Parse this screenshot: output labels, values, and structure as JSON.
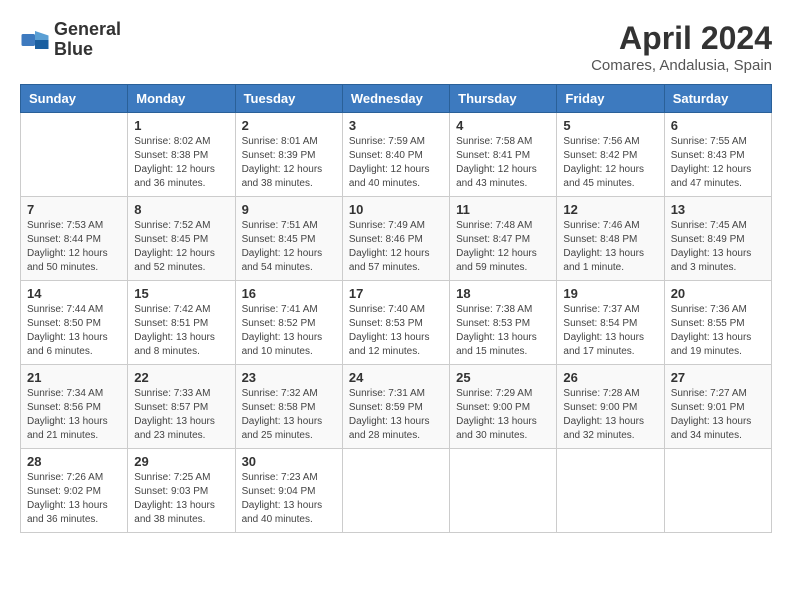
{
  "header": {
    "logo_line1": "General",
    "logo_line2": "Blue",
    "title": "April 2024",
    "subtitle": "Comares, Andalusia, Spain"
  },
  "weekdays": [
    "Sunday",
    "Monday",
    "Tuesday",
    "Wednesday",
    "Thursday",
    "Friday",
    "Saturday"
  ],
  "weeks": [
    [
      {
        "day": "",
        "info": ""
      },
      {
        "day": "1",
        "info": "Sunrise: 8:02 AM\nSunset: 8:38 PM\nDaylight: 12 hours\nand 36 minutes."
      },
      {
        "day": "2",
        "info": "Sunrise: 8:01 AM\nSunset: 8:39 PM\nDaylight: 12 hours\nand 38 minutes."
      },
      {
        "day": "3",
        "info": "Sunrise: 7:59 AM\nSunset: 8:40 PM\nDaylight: 12 hours\nand 40 minutes."
      },
      {
        "day": "4",
        "info": "Sunrise: 7:58 AM\nSunset: 8:41 PM\nDaylight: 12 hours\nand 43 minutes."
      },
      {
        "day": "5",
        "info": "Sunrise: 7:56 AM\nSunset: 8:42 PM\nDaylight: 12 hours\nand 45 minutes."
      },
      {
        "day": "6",
        "info": "Sunrise: 7:55 AM\nSunset: 8:43 PM\nDaylight: 12 hours\nand 47 minutes."
      }
    ],
    [
      {
        "day": "7",
        "info": "Sunrise: 7:53 AM\nSunset: 8:44 PM\nDaylight: 12 hours\nand 50 minutes."
      },
      {
        "day": "8",
        "info": "Sunrise: 7:52 AM\nSunset: 8:45 PM\nDaylight: 12 hours\nand 52 minutes."
      },
      {
        "day": "9",
        "info": "Sunrise: 7:51 AM\nSunset: 8:45 PM\nDaylight: 12 hours\nand 54 minutes."
      },
      {
        "day": "10",
        "info": "Sunrise: 7:49 AM\nSunset: 8:46 PM\nDaylight: 12 hours\nand 57 minutes."
      },
      {
        "day": "11",
        "info": "Sunrise: 7:48 AM\nSunset: 8:47 PM\nDaylight: 12 hours\nand 59 minutes."
      },
      {
        "day": "12",
        "info": "Sunrise: 7:46 AM\nSunset: 8:48 PM\nDaylight: 13 hours\nand 1 minute."
      },
      {
        "day": "13",
        "info": "Sunrise: 7:45 AM\nSunset: 8:49 PM\nDaylight: 13 hours\nand 3 minutes."
      }
    ],
    [
      {
        "day": "14",
        "info": "Sunrise: 7:44 AM\nSunset: 8:50 PM\nDaylight: 13 hours\nand 6 minutes."
      },
      {
        "day": "15",
        "info": "Sunrise: 7:42 AM\nSunset: 8:51 PM\nDaylight: 13 hours\nand 8 minutes."
      },
      {
        "day": "16",
        "info": "Sunrise: 7:41 AM\nSunset: 8:52 PM\nDaylight: 13 hours\nand 10 minutes."
      },
      {
        "day": "17",
        "info": "Sunrise: 7:40 AM\nSunset: 8:53 PM\nDaylight: 13 hours\nand 12 minutes."
      },
      {
        "day": "18",
        "info": "Sunrise: 7:38 AM\nSunset: 8:53 PM\nDaylight: 13 hours\nand 15 minutes."
      },
      {
        "day": "19",
        "info": "Sunrise: 7:37 AM\nSunset: 8:54 PM\nDaylight: 13 hours\nand 17 minutes."
      },
      {
        "day": "20",
        "info": "Sunrise: 7:36 AM\nSunset: 8:55 PM\nDaylight: 13 hours\nand 19 minutes."
      }
    ],
    [
      {
        "day": "21",
        "info": "Sunrise: 7:34 AM\nSunset: 8:56 PM\nDaylight: 13 hours\nand 21 minutes."
      },
      {
        "day": "22",
        "info": "Sunrise: 7:33 AM\nSunset: 8:57 PM\nDaylight: 13 hours\nand 23 minutes."
      },
      {
        "day": "23",
        "info": "Sunrise: 7:32 AM\nSunset: 8:58 PM\nDaylight: 13 hours\nand 25 minutes."
      },
      {
        "day": "24",
        "info": "Sunrise: 7:31 AM\nSunset: 8:59 PM\nDaylight: 13 hours\nand 28 minutes."
      },
      {
        "day": "25",
        "info": "Sunrise: 7:29 AM\nSunset: 9:00 PM\nDaylight: 13 hours\nand 30 minutes."
      },
      {
        "day": "26",
        "info": "Sunrise: 7:28 AM\nSunset: 9:00 PM\nDaylight: 13 hours\nand 32 minutes."
      },
      {
        "day": "27",
        "info": "Sunrise: 7:27 AM\nSunset: 9:01 PM\nDaylight: 13 hours\nand 34 minutes."
      }
    ],
    [
      {
        "day": "28",
        "info": "Sunrise: 7:26 AM\nSunset: 9:02 PM\nDaylight: 13 hours\nand 36 minutes."
      },
      {
        "day": "29",
        "info": "Sunrise: 7:25 AM\nSunset: 9:03 PM\nDaylight: 13 hours\nand 38 minutes."
      },
      {
        "day": "30",
        "info": "Sunrise: 7:23 AM\nSunset: 9:04 PM\nDaylight: 13 hours\nand 40 minutes."
      },
      {
        "day": "",
        "info": ""
      },
      {
        "day": "",
        "info": ""
      },
      {
        "day": "",
        "info": ""
      },
      {
        "day": "",
        "info": ""
      }
    ]
  ]
}
